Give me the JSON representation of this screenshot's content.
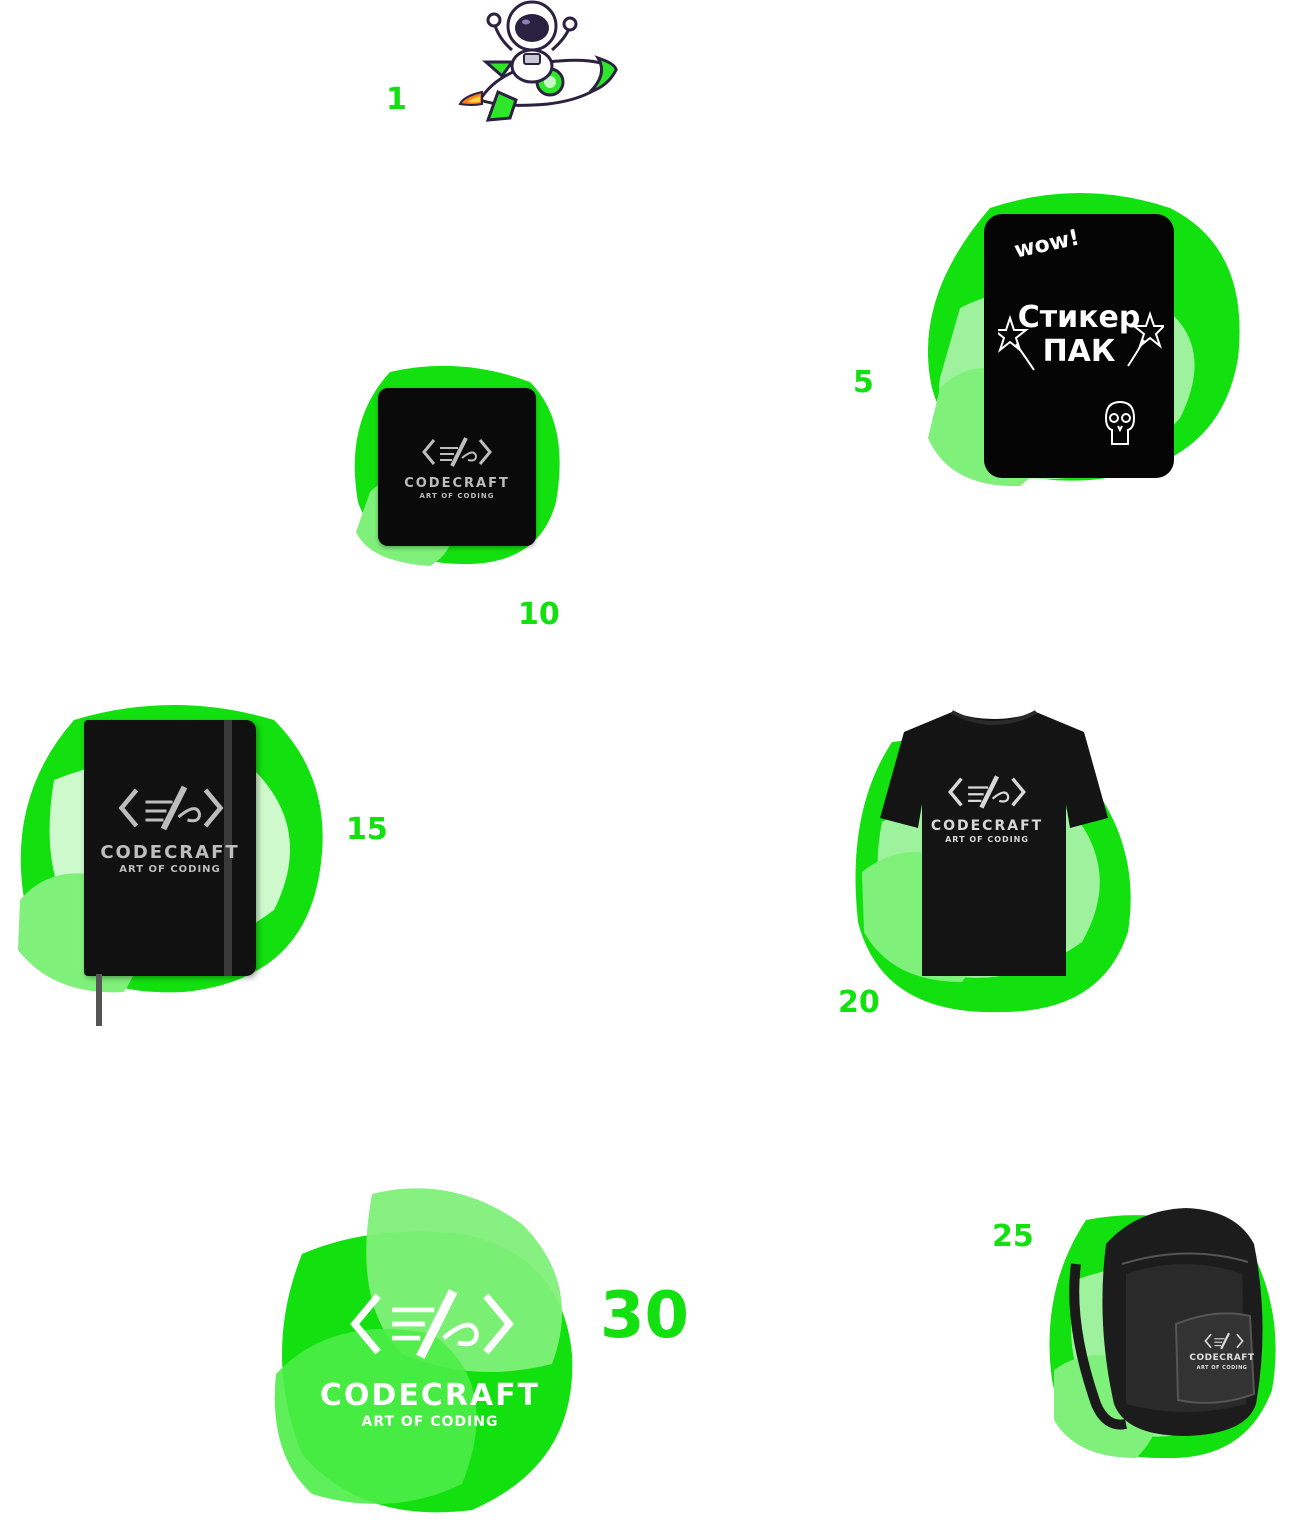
{
  "colors": {
    "accent": "#12e00f",
    "accent_light": "#7ff07a",
    "accent_pale": "#d9fad7",
    "product_dark": "#111111",
    "logo_grey": "#bdbdbd"
  },
  "milestones": [
    {
      "value": "1",
      "reward_icon": "astronaut-rocket-icon"
    },
    {
      "value": "5",
      "reward": "sticker-pack"
    },
    {
      "value": "10",
      "reward": "mousepad"
    },
    {
      "value": "15",
      "reward": "notebook"
    },
    {
      "value": "20",
      "reward": "t-shirt"
    },
    {
      "value": "25",
      "reward": "backpack"
    },
    {
      "value": "30",
      "reward": "brand-logo"
    }
  ],
  "brand": {
    "name": "CODECRAFT",
    "tagline": "ART OF CODING"
  },
  "sticker_pack": {
    "title_line1": "Стикер",
    "title_line2": "ПАК",
    "wow": "wow!"
  }
}
